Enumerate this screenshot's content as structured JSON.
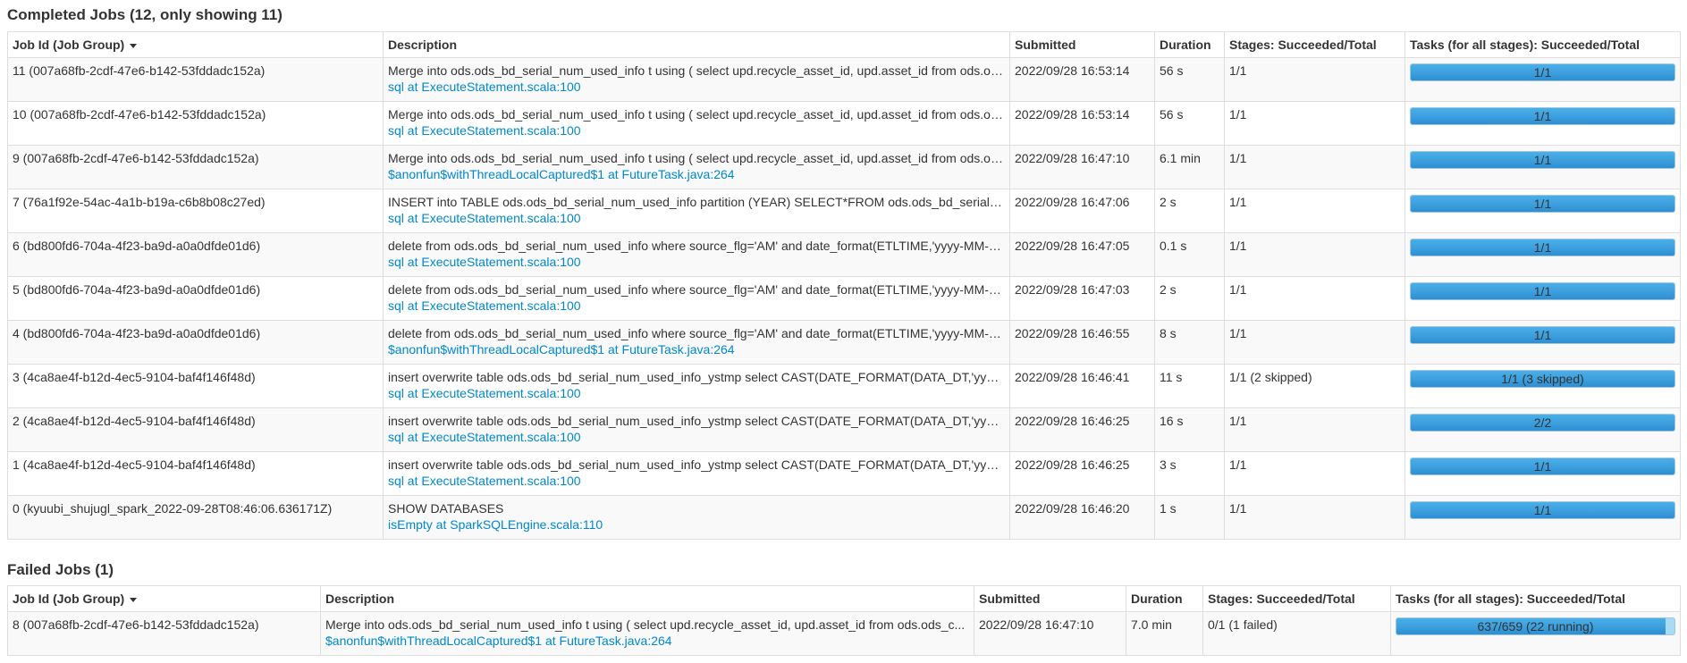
{
  "completed": {
    "title": "Completed Jobs (12, only showing 11)",
    "headers": {
      "job_id": "Job Id (Job Group)",
      "description": "Description",
      "submitted": "Submitted",
      "duration": "Duration",
      "stages": "Stages: Succeeded/Total",
      "tasks": "Tasks (for all stages): Succeeded/Total"
    },
    "rows": [
      {
        "job_id": "11 (007a68fb-2cdf-47e6-b142-53fddadc152a)",
        "desc": "Merge into ods.ods_bd_serial_num_used_info t using ( select upd.recycle_asset_id, upd.asset_id from ods.ods_c...",
        "link": "sql at ExecuteStatement.scala:100",
        "submitted": "2022/09/28 16:53:14",
        "duration": "56 s",
        "stages": "1/1",
        "tasks_label": "1/1",
        "tasks_fraction": 1.0
      },
      {
        "job_id": "10 (007a68fb-2cdf-47e6-b142-53fddadc152a)",
        "desc": "Merge into ods.ods_bd_serial_num_used_info t using ( select upd.recycle_asset_id, upd.asset_id from ods.ods_c...",
        "link": "sql at ExecuteStatement.scala:100",
        "submitted": "2022/09/28 16:53:14",
        "duration": "56 s",
        "stages": "1/1",
        "tasks_label": "1/1",
        "tasks_fraction": 1.0
      },
      {
        "job_id": "9 (007a68fb-2cdf-47e6-b142-53fddadc152a)",
        "desc": "Merge into ods.ods_bd_serial_num_used_info t using ( select upd.recycle_asset_id, upd.asset_id from ods.ods_c...",
        "link": "$anonfun$withThreadLocalCaptured$1 at FutureTask.java:264",
        "submitted": "2022/09/28 16:47:10",
        "duration": "6.1 min",
        "stages": "1/1",
        "tasks_label": "1/1",
        "tasks_fraction": 1.0
      },
      {
        "job_id": "7 (76a1f92e-54ac-4a1b-b19a-c6b8b08c27ed)",
        "desc": "INSERT into TABLE ods.ods_bd_serial_num_used_info partition (YEAR) SELECT*FROM ods.ods_bd_serial_num_used_info_ystmp",
        "link": "sql at ExecuteStatement.scala:100",
        "submitted": "2022/09/28 16:47:06",
        "duration": "2 s",
        "stages": "1/1",
        "tasks_label": "1/1",
        "tasks_fraction": 1.0
      },
      {
        "job_id": "6 (bd800fd6-704a-4f23-ba9d-a0a0dfde01d6)",
        "desc": "delete from ods.ods_bd_serial_num_used_info where source_flg='AM' and date_format(ETLTIME,'yyyy-MM-dd')=...",
        "link": "sql at ExecuteStatement.scala:100",
        "submitted": "2022/09/28 16:47:05",
        "duration": "0.1 s",
        "stages": "1/1",
        "tasks_label": "1/1",
        "tasks_fraction": 1.0
      },
      {
        "job_id": "5 (bd800fd6-704a-4f23-ba9d-a0a0dfde01d6)",
        "desc": "delete from ods.ods_bd_serial_num_used_info where source_flg='AM' and date_format(ETLTIME,'yyyy-MM-dd')=...",
        "link": "sql at ExecuteStatement.scala:100",
        "submitted": "2022/09/28 16:47:03",
        "duration": "2 s",
        "stages": "1/1",
        "tasks_label": "1/1",
        "tasks_fraction": 1.0
      },
      {
        "job_id": "4 (bd800fd6-704a-4f23-ba9d-a0a0dfde01d6)",
        "desc": "delete from ods.ods_bd_serial_num_used_info where source_flg='AM' and date_format(ETLTIME,'yyyy-MM-dd')=...",
        "link": "$anonfun$withThreadLocalCaptured$1 at FutureTask.java:264",
        "submitted": "2022/09/28 16:46:55",
        "duration": "8 s",
        "stages": "1/1",
        "tasks_label": "1/1",
        "tasks_fraction": 1.0
      },
      {
        "job_id": "3 (4ca8ae4f-b12d-4ec5-9104-baf4f146f48d)",
        "desc": "insert overwrite table ods.ods_bd_serial_num_used_info_ystmp select CAST(DATE_FORMAT(DATA_DT,'yyyy') AS INT)",
        "link": "sql at ExecuteStatement.scala:100",
        "submitted": "2022/09/28 16:46:41",
        "duration": "11 s",
        "stages": "1/1 (2 skipped)",
        "tasks_label": "1/1 (3 skipped)",
        "tasks_fraction": 1.0
      },
      {
        "job_id": "2 (4ca8ae4f-b12d-4ec5-9104-baf4f146f48d)",
        "desc": "insert overwrite table ods.ods_bd_serial_num_used_info_ystmp select CAST(DATE_FORMAT(DATA_DT,'yyyy') AS INT)",
        "link": "sql at ExecuteStatement.scala:100",
        "submitted": "2022/09/28 16:46:25",
        "duration": "16 s",
        "stages": "1/1",
        "tasks_label": "2/2",
        "tasks_fraction": 1.0
      },
      {
        "job_id": "1 (4ca8ae4f-b12d-4ec5-9104-baf4f146f48d)",
        "desc": "insert overwrite table ods.ods_bd_serial_num_used_info_ystmp select CAST(DATE_FORMAT(DATA_DT,'yyyy') AS INT)",
        "link": "sql at ExecuteStatement.scala:100",
        "submitted": "2022/09/28 16:46:25",
        "duration": "3 s",
        "stages": "1/1",
        "tasks_label": "1/1",
        "tasks_fraction": 1.0
      },
      {
        "job_id": "0 (kyuubi_shujugl_spark_2022-09-28T08:46:06.636171Z)",
        "desc": "SHOW DATABASES",
        "link": "isEmpty at SparkSQLEngine.scala:110",
        "submitted": "2022/09/28 16:46:20",
        "duration": "1 s",
        "stages": "1/1",
        "tasks_label": "1/1",
        "tasks_fraction": 1.0
      }
    ]
  },
  "failed": {
    "title": "Failed Jobs (1)",
    "headers": {
      "job_id": "Job Id (Job Group)",
      "description": "Description",
      "submitted": "Submitted",
      "duration": "Duration",
      "stages": "Stages: Succeeded/Total",
      "tasks": "Tasks (for all stages): Succeeded/Total"
    },
    "rows": [
      {
        "job_id": "8 (007a68fb-2cdf-47e6-b142-53fddadc152a)",
        "desc": "Merge into ods.ods_bd_serial_num_used_info t using ( select upd.recycle_asset_id, upd.asset_id from ods.ods_c...",
        "link": "$anonfun$withThreadLocalCaptured$1 at FutureTask.java:264",
        "submitted": "2022/09/28 16:47:10",
        "duration": "7.0 min",
        "stages": "0/1 (1 failed)",
        "tasks_label": "637/659 (22 running)",
        "tasks_fraction": 0.9666,
        "tasks_running_fraction": 0.0334
      }
    ]
  },
  "colors": {
    "link": "#0088cc",
    "progress_fill": "#3ea0de",
    "progress_running": "#a8dcf4",
    "row_stripe": "#f9f9f9",
    "border": "#dddddd"
  },
  "icons": {
    "sort": "sort-desc-arrow-icon"
  }
}
